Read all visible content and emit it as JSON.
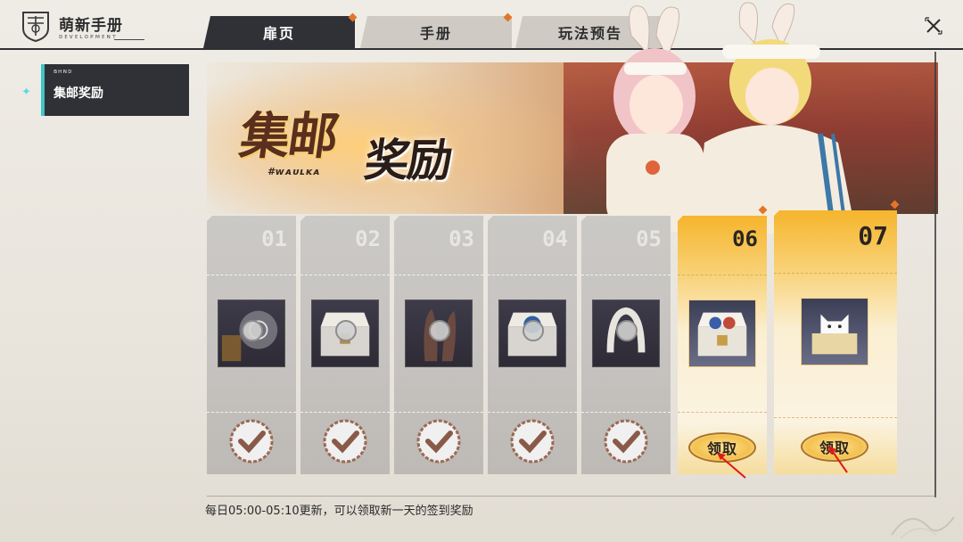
{
  "app": {
    "title": "萌新手册",
    "subtitle": "ᴅᴇᴠᴇʟᴏᴘᴍᴇɴᴛ"
  },
  "tabs": [
    {
      "label": "扉页",
      "active": true
    },
    {
      "label": "手册",
      "active": false,
      "badge": true
    },
    {
      "label": "玩法预告",
      "active": false
    }
  ],
  "sidebar": {
    "items": [
      {
        "tag": "ʙʜɴᴅ",
        "label": "集邮奖励",
        "active": true
      }
    ]
  },
  "banner": {
    "title_1": "集邮",
    "title_2": "奖励",
    "deco": "#ᴡᴀᴜʟᴋᴀ"
  },
  "cards": [
    {
      "day": "01",
      "claimed": true,
      "item": "luggage-compass-icon"
    },
    {
      "day": "02",
      "claimed": true,
      "item": "silver-chest-icon"
    },
    {
      "day": "03",
      "claimed": true,
      "item": "bunny-ears-icon"
    },
    {
      "day": "04",
      "claimed": true,
      "item": "blue-chest-icon"
    },
    {
      "day": "05",
      "claimed": true,
      "item": "headband-icon"
    },
    {
      "day": "06",
      "claimed": false,
      "item": "gold-chest-icon",
      "button": "领取"
    },
    {
      "day": "07",
      "claimed": false,
      "item": "cat-box-icon",
      "button": "领取"
    }
  ],
  "footer": {
    "note": "每日05:00-05:10更新，可以领取新一天的签到奖励"
  },
  "colors": {
    "accent": "#3fc4c8",
    "dark": "#2f3136",
    "gold": "#f4c14f",
    "badge": "#e3752b"
  }
}
